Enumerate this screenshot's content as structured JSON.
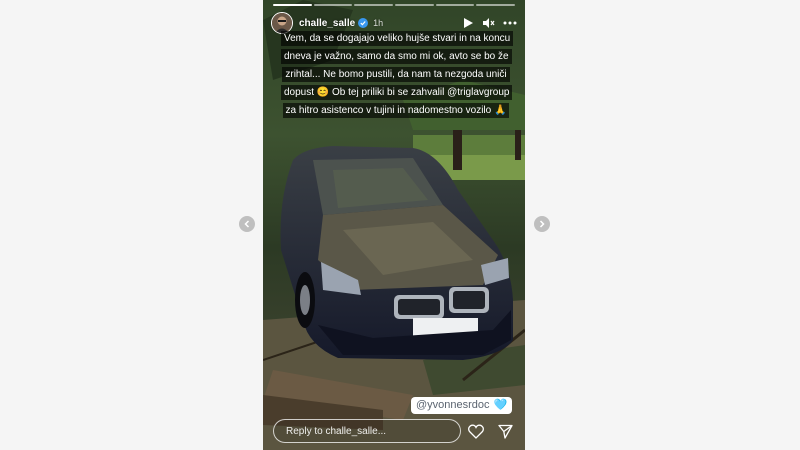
{
  "story": {
    "username": "challe_salle",
    "time": "1h",
    "caption": "Vem, da se dogajajo veliko hujše stvari in na koncu dneva je važno, samo da smo mi ok, avto se bo že zrihtal... Ne bomo pustili, da nam ta nezgoda uniči dopust 😊 Ob tej priliki bi se zahvalil @triglavgroup za hitro asistenco v tujini in nadomestno vozilo 🙏",
    "mention": "@yvonnesrdoc",
    "mention_emoji": "🩵",
    "progress_segments": 6,
    "active_segment": 0
  },
  "reply": {
    "placeholder": "Reply to challe_salle..."
  },
  "icons": {
    "play": "play-icon",
    "mute": "mute-icon",
    "more": "more-icon",
    "like": "heart-icon",
    "share": "send-icon",
    "prev": "chevron-left-icon",
    "next": "chevron-right-icon",
    "verified": "verified-badge-icon"
  },
  "colors": {
    "page_background": "#f5f5f5",
    "verified": "#3897f0",
    "nav_button": "#bfbfbf",
    "car_body": "#1c2233"
  }
}
